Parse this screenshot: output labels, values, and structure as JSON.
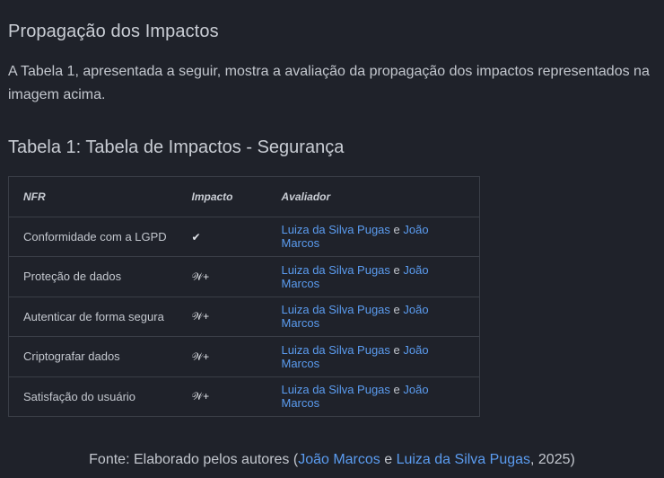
{
  "section_title": "Propagação dos Impactos",
  "intro": "A Tabela 1, apresentada a seguir, mostra a avaliação da propagação dos impactos representados na imagem acima.",
  "table_title": "Tabela 1: Tabela de Impactos - Segurança",
  "table": {
    "headers": [
      "NFR",
      "Impacto",
      "Avaliador"
    ],
    "rows": [
      {
        "nfr": "Conformidade com a LGPD",
        "impact": "✔",
        "evaluator_1": "Luiza da Silva Pugas",
        "conjunction": "e",
        "evaluator_2": "João Marcos"
      },
      {
        "nfr": "Proteção de dados",
        "impact": "𝒲+",
        "evaluator_1": "Luiza da Silva Pugas",
        "conjunction": "e",
        "evaluator_2": "João Marcos"
      },
      {
        "nfr": "Autenticar de forma segura",
        "impact": "𝒲+",
        "evaluator_1": "Luiza da Silva Pugas",
        "conjunction": "e",
        "evaluator_2": "João Marcos"
      },
      {
        "nfr": "Criptografar dados",
        "impact": "𝒲+",
        "evaluator_1": "Luiza da Silva Pugas",
        "conjunction": "e",
        "evaluator_2": "João Marcos"
      },
      {
        "nfr": "Satisfação do usuário",
        "impact": "𝒲+",
        "evaluator_1": "Luiza da Silva Pugas",
        "conjunction": "e",
        "evaluator_2": "João Marcos"
      }
    ]
  },
  "source": {
    "prefix": "Fonte: Elaborado pelos autores (",
    "author_1": "João Marcos",
    "conjunction": " e ",
    "author_2": "Luiza da Silva Pugas",
    "suffix": ", 2025)"
  },
  "colors": {
    "background": "#1f222a",
    "text": "#c3c7ce",
    "link": "#5b9cf0",
    "border": "#3a3e47"
  }
}
